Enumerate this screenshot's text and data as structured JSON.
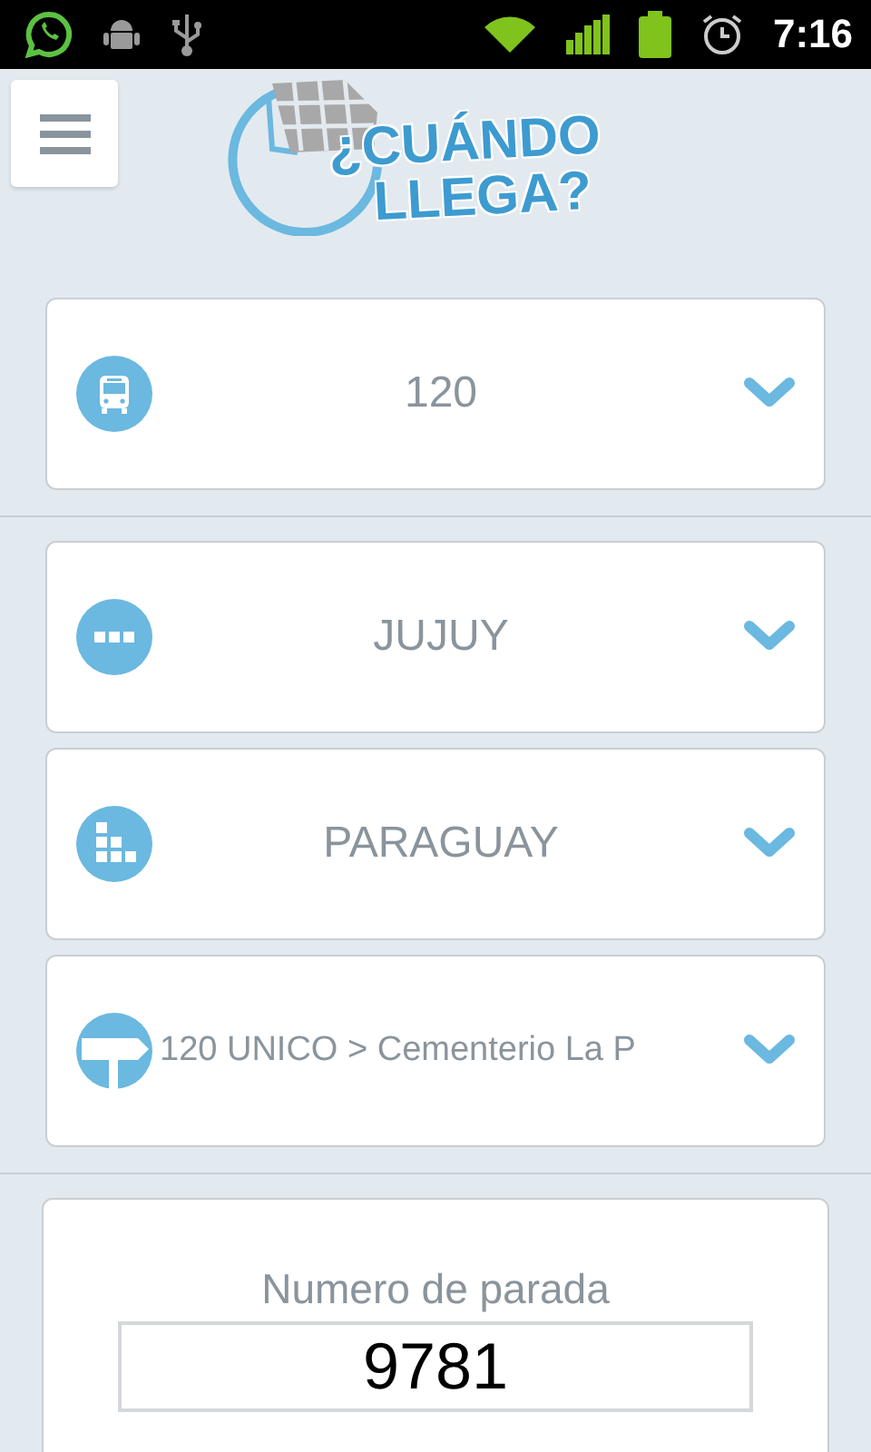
{
  "status_bar": {
    "time": "7:16"
  },
  "logo": {
    "line1": "¿CUÁNDO",
    "line2": "LLEGA?"
  },
  "selectors": [
    {
      "value": "120"
    },
    {
      "value": "JUJUY"
    },
    {
      "value": "PARAGUAY"
    },
    {
      "value": "120 UNICO > Cementerio La P"
    }
  ],
  "stop_form": {
    "label": "Numero de parada",
    "value": "9781"
  }
}
